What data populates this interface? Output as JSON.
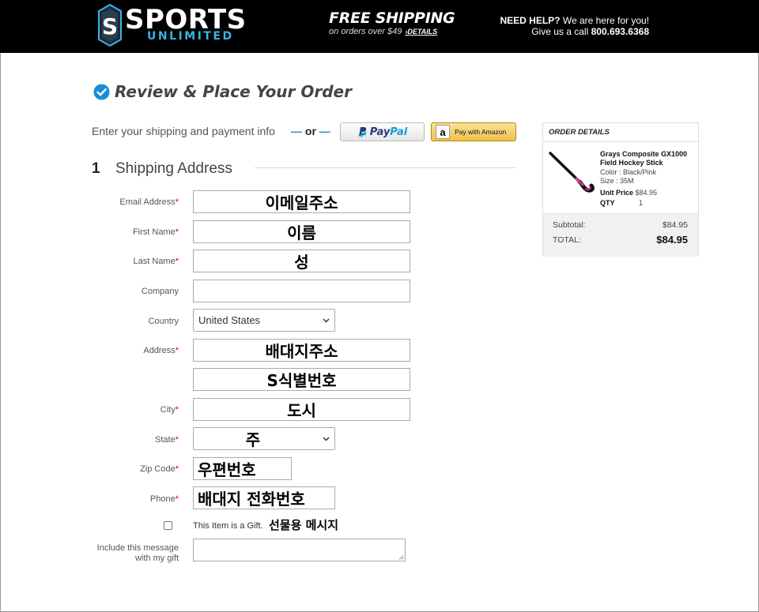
{
  "header": {
    "logo": {
      "word1": "SPORTS",
      "word2": "UNLIMITED",
      "shield_letter": "S"
    },
    "shipping": {
      "title": "FREE SHIPPING",
      "subtitle": "on orders over $49",
      "details_link": "›DETAILS"
    },
    "help": {
      "line1_bold": "NEED HELP?",
      "line1_rest": " We are here for you!",
      "line2_rest": "Give us a call ",
      "phone": "800.693.6368"
    }
  },
  "page": {
    "title": "Review & Place Your Order",
    "pay_info": "Enter your shipping and payment info",
    "or_text": "or",
    "paypal_label_a": "Pay",
    "paypal_label_b": "Pal",
    "amazon_label": "Pay with Amazon",
    "amazon_letter": "a"
  },
  "section": {
    "number": "1",
    "title": "Shipping Address"
  },
  "form": {
    "email": {
      "label": "Email Address",
      "value": "이메일주소"
    },
    "first_name": {
      "label": "First Name",
      "value": "이름"
    },
    "last_name": {
      "label": "Last Name",
      "value": "성"
    },
    "company": {
      "label": "Company",
      "value": ""
    },
    "country": {
      "label": "Country",
      "value": "United States"
    },
    "address": {
      "label": "Address",
      "value": "배대지주소",
      "value2": "S식별번호"
    },
    "city": {
      "label": "City",
      "value": "도시"
    },
    "state": {
      "label": "State",
      "value": "주"
    },
    "zip": {
      "label": "Zip Code",
      "value": "우편번호"
    },
    "phone": {
      "label": "Phone",
      "value": "배대지 전화번호"
    },
    "gift": {
      "label": "This Item is a Gift.",
      "note": "선물용 메시지",
      "checked": false
    },
    "gift_message": {
      "label_line1": "Include this message",
      "label_line2": "with my gift",
      "value": ""
    },
    "required_mark": "*"
  },
  "order_details": {
    "heading": "ORDER DETAILS",
    "item": {
      "name": "Grays Composite GX1000 Field Hockey Stick",
      "color": "Color : Black/Pink",
      "size": "Size : 35M",
      "unit_price_label": "Unit Price",
      "unit_price": "$84.95",
      "qty_label": "QTY",
      "qty": "1"
    },
    "subtotal_label": "Subtotal:",
    "subtotal": "$84.95",
    "total_label": "TOTAL:",
    "total": "$84.95"
  },
  "colors": {
    "header_bg": "#000000",
    "accent_blue": "#3ab4e6",
    "required_red": "#d0021b",
    "amazon_yellow": "#f0c14b"
  }
}
